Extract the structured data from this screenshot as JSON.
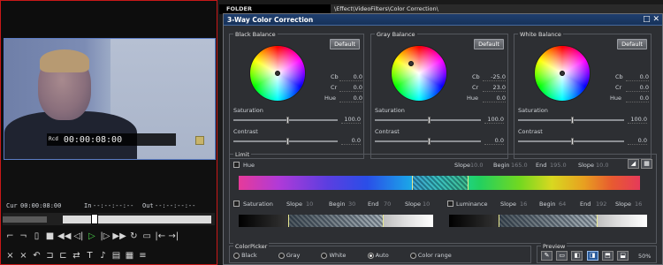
{
  "player": {
    "timecode_prefix": "Rcd",
    "timecode": "00:00:08:00",
    "cur_label": "Cur",
    "cur_value": "00:00:08:00",
    "in_label": "In",
    "in_value": "--:--:--:--",
    "out_label": "Out",
    "out_value": "--:--:--:--"
  },
  "folder": {
    "label": "FOLDER",
    "path": "\\Effect\\VideoFilters\\Color Correction\\"
  },
  "dialog": {
    "title": "3-Way Color Correction",
    "default_label": "Default",
    "balances": [
      {
        "title": "Black Balance",
        "cb": "0.0",
        "cr": "0.0",
        "hue": "0.0",
        "saturation": "100.0",
        "contrast": "0.0"
      },
      {
        "title": "Gray Balance",
        "cb": "-25.0",
        "cr": "23.0",
        "hue": "0.0",
        "saturation": "100.0",
        "contrast": "0.0"
      },
      {
        "title": "White Balance",
        "cb": "0.0",
        "cr": "0.0",
        "hue": "0.0",
        "saturation": "100.0",
        "contrast": "0.0"
      }
    ],
    "labels": {
      "cb": "Cb",
      "cr": "Cr",
      "hue": "Hue",
      "saturation": "Saturation",
      "contrast": "Contrast"
    },
    "limit": {
      "title": "Limit",
      "hue": {
        "label": "Hue",
        "slope1_label": "Slope",
        "slope1": "10.0",
        "begin_label": "Begin",
        "begin": "165.0",
        "end_label": "End",
        "end": "195.0",
        "slope2_label": "Slope",
        "slope2": "10.0"
      },
      "saturation": {
        "label": "Saturation",
        "slope1_label": "Slope",
        "slope1": "10",
        "begin_label": "Begin",
        "begin": "30",
        "end_label": "End",
        "end": "70",
        "slope2_label": "Slope",
        "slope2": "10"
      },
      "luminance": {
        "label": "Luminance",
        "slope1_label": "Slope",
        "slope1": "16",
        "begin_label": "Begin",
        "begin": "64",
        "end_label": "End",
        "end": "192",
        "slope2_label": "Slope",
        "slope2": "16"
      }
    },
    "colorpicker": {
      "title": "ColorPicker",
      "options": [
        "Black",
        "Gray",
        "White",
        "Auto",
        "Color range"
      ],
      "selected": "Auto"
    },
    "preview": {
      "title": "Preview",
      "zoom": "50%"
    }
  }
}
